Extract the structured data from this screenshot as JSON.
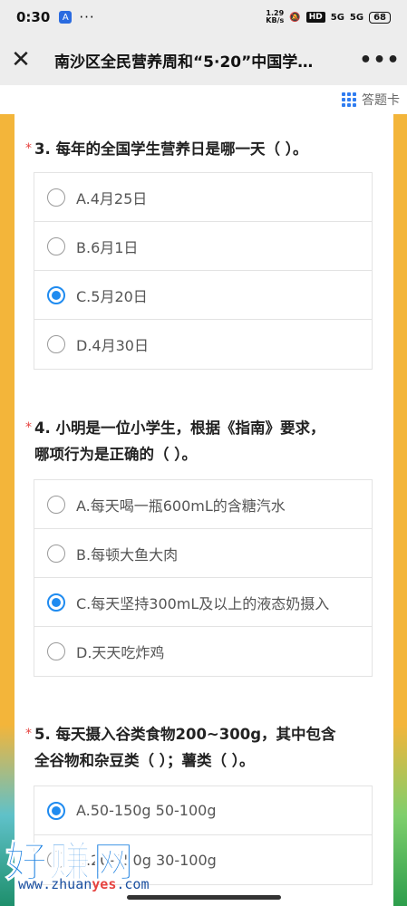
{
  "status": {
    "time": "0:30",
    "app_icon": "A",
    "dots": "···",
    "speed_top": "1.29",
    "speed_bottom": "KB/s",
    "hd": "HD",
    "sig1": "5G",
    "sig2": "5G",
    "battery": "68"
  },
  "nav": {
    "close": "✕",
    "title": "南沙区全民营养周和“5·20”中国学…",
    "more": "•••"
  },
  "answer_card": {
    "label": "答题卡"
  },
  "questions": [
    {
      "star": "*",
      "title": "3. 每年的全国学生营养日是哪一天（  ）。",
      "options": [
        {
          "label": "A.4月25日",
          "checked": false
        },
        {
          "label": "B.6月1日",
          "checked": false
        },
        {
          "label": "C.5月20日",
          "checked": true
        },
        {
          "label": "D.4月30日",
          "checked": false
        }
      ]
    },
    {
      "star": "*",
      "title_line1": "4. 小明是一位小学生，根据《指南》要求，",
      "title_line2": "哪项行为是正确的（  ）。",
      "options": [
        {
          "label": "A.每天喝一瓶600mL的含糖汽水",
          "checked": false
        },
        {
          "label": "B.每顿大鱼大肉",
          "checked": false
        },
        {
          "label": "C.每天坚持300mL及以上的液态奶摄入",
          "checked": true
        },
        {
          "label": "D.天天吃炸鸡",
          "checked": false
        }
      ]
    },
    {
      "star": "*",
      "title_line1": "5. 每天摄入谷类食物200~300g，其中包含",
      "title_line2": "全谷物和杂豆类（  ）；薯类（  ）。",
      "options": [
        {
          "label": "A.50-150g 50-100g",
          "checked": true
        },
        {
          "label": "B.20-150g 30-100g",
          "checked": false
        }
      ]
    }
  ],
  "watermark": {
    "big": "好赚网",
    "url_pre": "www.zhuan",
    "url_mid": "yes",
    "url_post": ".com"
  },
  "colors": {
    "accent": "#1f8bf0",
    "required": "#e64340",
    "background": "#f3b53a"
  }
}
